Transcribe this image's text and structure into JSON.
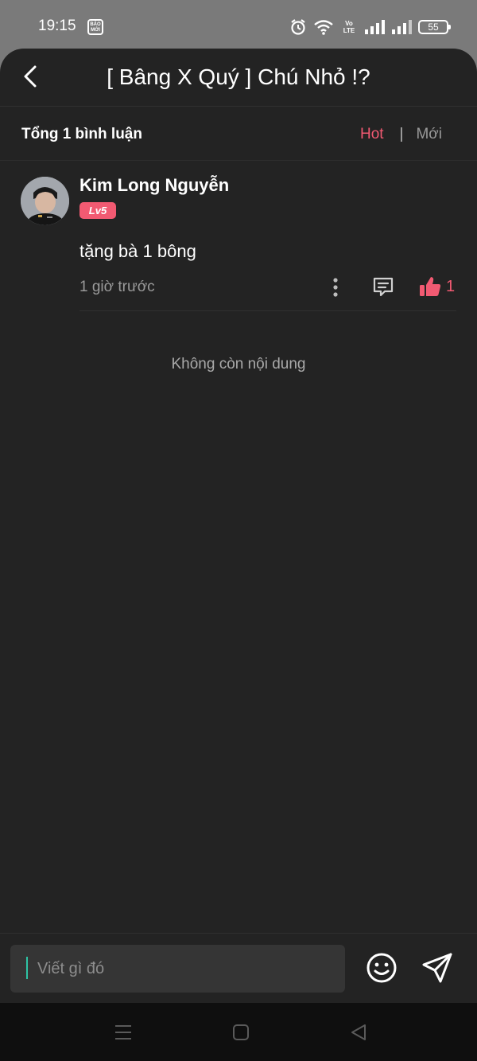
{
  "status_bar": {
    "time": "19:15",
    "news_badge": "BÁO MỚI",
    "volte": "Vo LTE",
    "battery": "55",
    "icons": [
      "alarm-icon",
      "wifi-icon",
      "signal-icon",
      "signal-icon",
      "battery-icon"
    ]
  },
  "header": {
    "title": "[ Bâng X Quý ] Chú Nhỏ !?",
    "back_icon": "chevron-left-icon"
  },
  "comments_header": {
    "total": "Tổng 1 bình luận",
    "sort_hot": "Hot",
    "sort_separator": "|",
    "sort_new": "Mới",
    "active_sort": "Hot"
  },
  "comments": [
    {
      "author": "Kim Long Nguyễn",
      "level": "Lv5",
      "text": "tặng bà 1 bông",
      "time": "1 giờ trước",
      "likes": "1"
    }
  ],
  "empty_state": "Không còn nội dung",
  "composer": {
    "placeholder": "Viết gì đó",
    "value": "",
    "emoji_icon": "smiley-icon",
    "send_icon": "send-icon"
  },
  "colors": {
    "accent": "#f25a72",
    "background": "#232323",
    "input_background": "#353535",
    "caret": "#2ec4a5"
  }
}
